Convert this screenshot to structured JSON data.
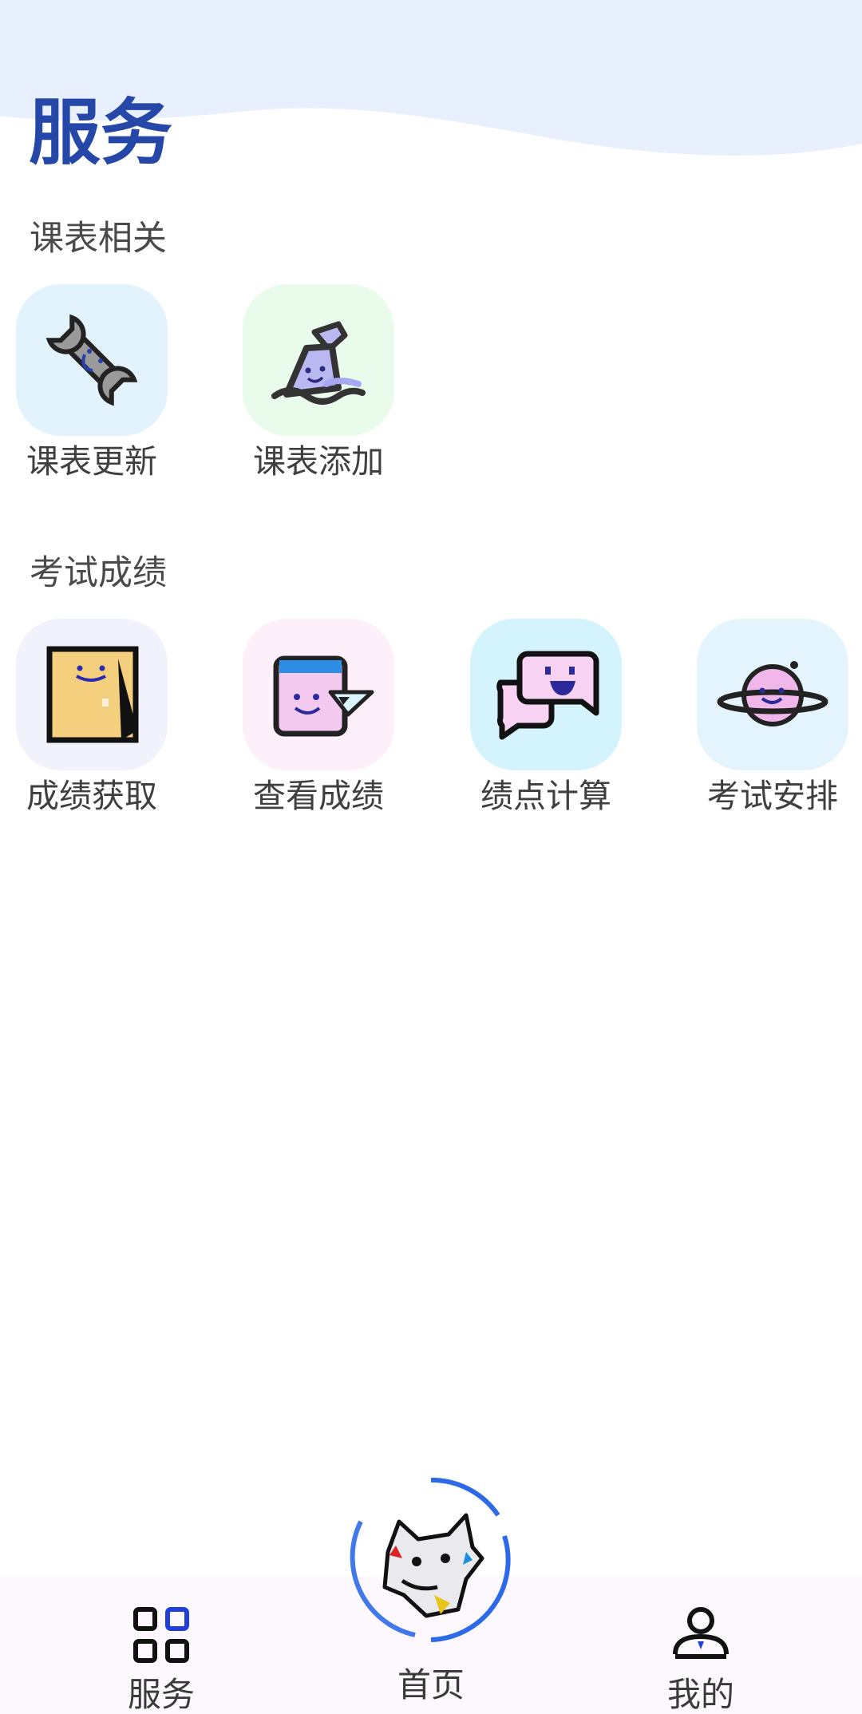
{
  "header": {
    "title": "服务"
  },
  "sections": [
    {
      "title": "课表相关",
      "items": [
        {
          "label": "课表更新",
          "icon": "wrench-icon",
          "bg": "#e3f3fd"
        },
        {
          "label": "课表添加",
          "icon": "shovel-icon",
          "bg": "#e9fbea"
        }
      ]
    },
    {
      "title": "考试成绩",
      "items": [
        {
          "label": "成绩获取",
          "icon": "bag-icon",
          "bg": "#f1f2fc"
        },
        {
          "label": "查看成绩",
          "icon": "card-ruler-icon",
          "bg": "#fdf0fb"
        },
        {
          "label": "绩点计算",
          "icon": "chat-bubbles-icon",
          "bg": "#d3f3fd"
        },
        {
          "label": "考试安排",
          "icon": "planet-icon",
          "bg": "#e4f4fd"
        }
      ]
    }
  ],
  "bottom_nav": {
    "services": {
      "label": "服务",
      "icon": "grid-icon"
    },
    "home": {
      "label": "首页",
      "icon": "dog-logo-icon"
    },
    "mine": {
      "label": "我的",
      "icon": "person-icon"
    }
  },
  "colors": {
    "title": "#2547a8",
    "wave": "#e8effd",
    "accent": "#2d6ae8",
    "bottom_bar": "#fdf8fd"
  }
}
